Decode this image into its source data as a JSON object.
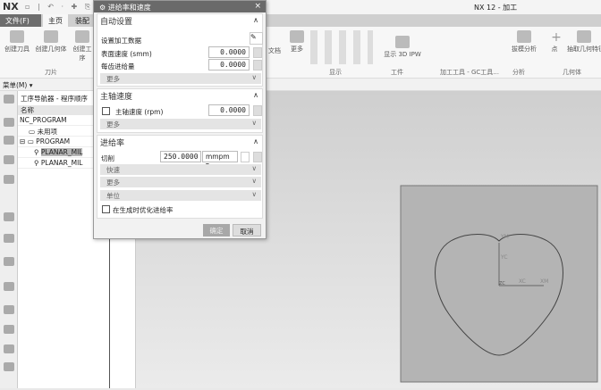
{
  "app": {
    "logo": "NX",
    "title": "NX 12 - 加工",
    "quick_access": "▫ | ↶ · ✚ ⎘ ⎙"
  },
  "tabs": [
    {
      "label": "文件(F)"
    },
    {
      "label": "主页"
    },
    {
      "label": "装配"
    }
  ],
  "ribbon": {
    "buttons": [
      "创建刀具",
      "创建几何体",
      "创建工序",
      "更多",
      "显示 3D IPW",
      "拔模分析",
      "点",
      "抽取几何特征"
    ],
    "groups": [
      "刀片",
      "显示",
      "工件",
      "加工工具 - GC工具...",
      "分析",
      "几何体"
    ],
    "partial_left": "文档"
  },
  "toolbar": {
    "menu": "菜单(M) ▾"
  },
  "navigator": {
    "title": "工序导航器 - 程序顺序",
    "column": "名称",
    "rows": [
      {
        "label": "NC_PROGRAM"
      },
      {
        "label": "未用项"
      },
      {
        "label": "PROGRAM"
      },
      {
        "label": "PLANAR_MIL"
      },
      {
        "label": "PLANAR_MIL"
      }
    ]
  },
  "dialog": {
    "title": "进给率和速度",
    "close": "×",
    "auto": {
      "header": "自动设置",
      "set_data": "设置加工数据",
      "surface_speed_label": "表面速度 (smm)",
      "surface_speed": "0.0000",
      "feed_per_tooth_label": "每齿进给量",
      "feed_per_tooth": "0.0000",
      "more": "更多"
    },
    "spindle": {
      "header": "主轴速度",
      "label": "主轴速度 (rpm)",
      "value": "0.0000",
      "checked": false,
      "more": "更多"
    },
    "feed": {
      "header": "进给率",
      "cut_label": "切削",
      "cut_value": "250.0000",
      "unit": "mmpm ▾",
      "rapid": "快速",
      "more": "更多",
      "units": "单位",
      "optimize": "在生成时优化进给率",
      "optimize_checked": false
    },
    "ok": "确定",
    "cancel": "取消"
  },
  "viewport": {
    "labels": {
      "ym": "YM",
      "yc": "YC",
      "zc": "ZC",
      "xc": "XC",
      "xm": "XM"
    }
  }
}
